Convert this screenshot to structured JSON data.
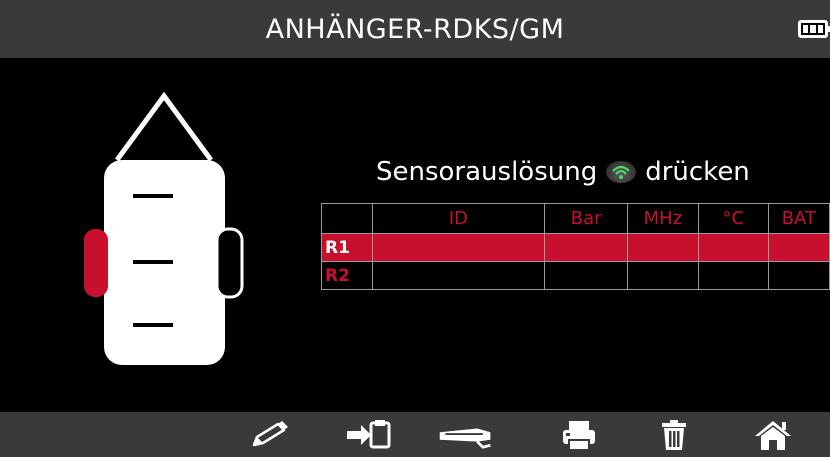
{
  "header": {
    "title": "ANHÄNGER-RDKS/GM",
    "battery_icon": "battery-full-icon"
  },
  "vehicle": {
    "icon": "trailer-axle-diagram",
    "selected_wheel": "left",
    "colors": {
      "body": "#ffffff",
      "selected": "#c8102e",
      "axle": "#000000"
    }
  },
  "prompt": {
    "before": "Sensorauslösung",
    "after": "drücken",
    "icon": "sensor-trigger-button-icon"
  },
  "table": {
    "columns": [
      "",
      "ID",
      "Bar",
      "MHz",
      "°C",
      "BAT"
    ],
    "rows": [
      {
        "label": "R1",
        "cells": [
          "",
          "",
          "",
          "",
          ""
        ],
        "active": true
      },
      {
        "label": "R2",
        "cells": [
          "",
          "",
          "",
          "",
          ""
        ],
        "active": false
      }
    ]
  },
  "toolbar": {
    "items": [
      {
        "name": "edit-icon"
      },
      {
        "name": "transfer-to-tool-icon"
      },
      {
        "name": "obd-cable-icon"
      },
      {
        "name": "print-icon"
      },
      {
        "name": "delete-icon"
      },
      {
        "name": "home-icon"
      }
    ]
  },
  "colors": {
    "accent": "#c8102e",
    "header_bg": "#3a3a3a",
    "background": "#000000",
    "wifi_green": "#4cd964"
  }
}
